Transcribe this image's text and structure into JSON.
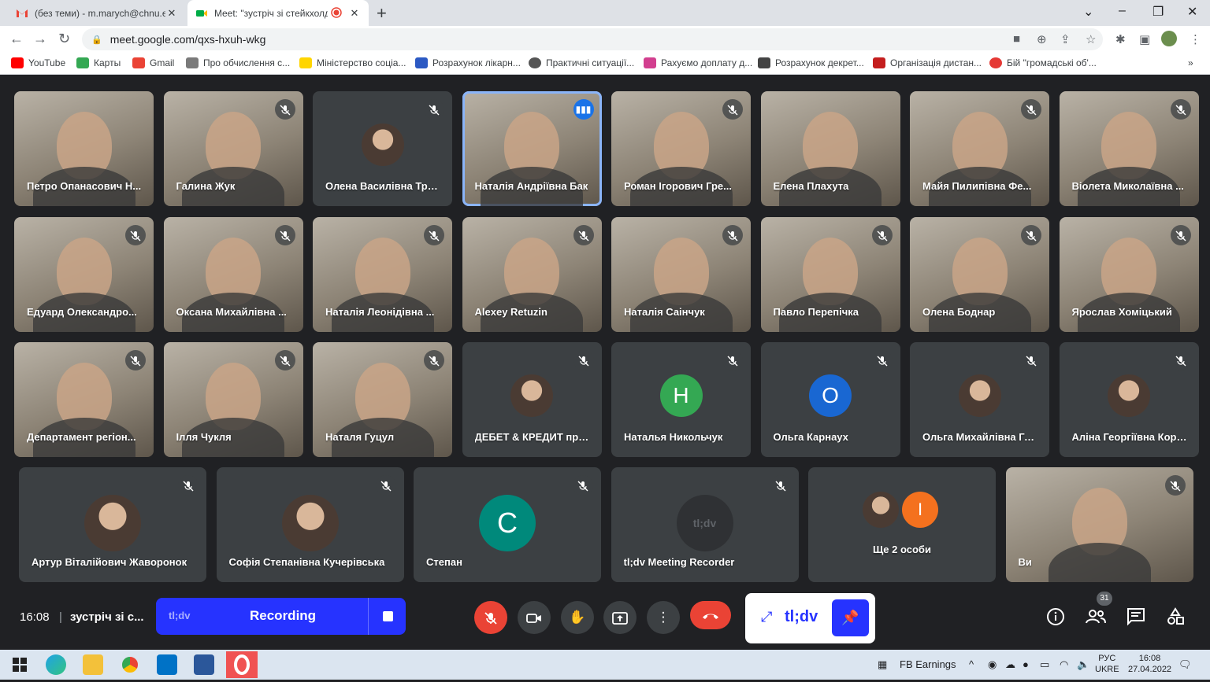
{
  "browser": {
    "tabs": [
      {
        "title": "(без теми) - m.marych@chnu.edu.ua"
      },
      {
        "title": "Meet: \"зустріч зі стейкхолдерами\""
      }
    ],
    "url": "meet.google.com/qxs-hxuh-wkg",
    "bookmarks": [
      "YouTube",
      "Карты",
      "Gmail",
      "Про обчислення с...",
      "Міністерство соціа...",
      "Розрахунок лікарн...",
      "Практичні ситуації...",
      "Рахуємо доплату д...",
      "Розрахунок декрет...",
      "Організація дистан...",
      "Бій \"громадські об'..."
    ]
  },
  "participants": [
    {
      "name": "Петро Опанасович Н...",
      "muted": false,
      "kind": "video"
    },
    {
      "name": "Галина Жук",
      "muted": true,
      "kind": "video"
    },
    {
      "name": "Олена Василівна Трет...",
      "muted": true,
      "kind": "photo"
    },
    {
      "name": "Наталія Андріївна Бак",
      "muted": false,
      "kind": "video",
      "speaking": true
    },
    {
      "name": "Роман Ігорович Гре...",
      "muted": true,
      "kind": "video"
    },
    {
      "name": "Елена Плахута",
      "muted": false,
      "kind": "video"
    },
    {
      "name": "Майя Пилипівна Фе...",
      "muted": true,
      "kind": "video"
    },
    {
      "name": "Віолета Миколаївна ...",
      "muted": true,
      "kind": "video"
    },
    {
      "name": "Едуард Олександро...",
      "muted": true,
      "kind": "video"
    },
    {
      "name": "Оксана Михайлівна ...",
      "muted": true,
      "kind": "video"
    },
    {
      "name": "Наталія Леонідівна ...",
      "muted": true,
      "kind": "video"
    },
    {
      "name": "Alexey Retuzin",
      "muted": true,
      "kind": "video"
    },
    {
      "name": "Наталія Саінчук",
      "muted": true,
      "kind": "video"
    },
    {
      "name": "Павло Перепічка",
      "muted": true,
      "kind": "video"
    },
    {
      "name": "Олена Боднар",
      "muted": true,
      "kind": "video"
    },
    {
      "name": "Ярослав Хоміцький",
      "muted": true,
      "kind": "video"
    },
    {
      "name": "Департамент регіон...",
      "muted": true,
      "kind": "video"
    },
    {
      "name": "Ілля Чукля",
      "muted": true,
      "kind": "video"
    },
    {
      "name": "Наталя Гуцул",
      "muted": true,
      "kind": "video"
    },
    {
      "name": "ДЕБЕТ & КРЕДИТ про...",
      "muted": true,
      "kind": "photo"
    },
    {
      "name": "Наталья Никольчук",
      "muted": true,
      "kind": "letter",
      "letter": "Н",
      "color": "#34a853"
    },
    {
      "name": "Ольга Карнаух",
      "muted": true,
      "kind": "letter",
      "letter": "О",
      "color": "#1967d2"
    },
    {
      "name": "Ольга Михайлівна Гл...",
      "muted": true,
      "kind": "photo"
    },
    {
      "name": "Аліна Георгіївна Корб...",
      "muted": true,
      "kind": "photo"
    },
    {
      "name": "Артур Віталійович Жаворонок",
      "muted": true,
      "kind": "photo"
    },
    {
      "name": "Софія Степанівна Кучерівська",
      "muted": true,
      "kind": "photo"
    },
    {
      "name": "Степан",
      "muted": true,
      "kind": "letter",
      "letter": "С",
      "color": "#00897b"
    },
    {
      "name": "tl;dv Meeting Recorder",
      "muted": true,
      "kind": "tldv",
      "logo": "tl;dv"
    },
    {
      "name": "Ще 2 особи",
      "muted": false,
      "kind": "more",
      "letter": "І",
      "color": "#f4711e"
    },
    {
      "name": "Ви",
      "muted": true,
      "kind": "video"
    }
  ],
  "meeting": {
    "time": "16:08",
    "separator": "|",
    "name": "зустріч зі с...",
    "people_count": "31"
  },
  "recording": {
    "brand": "tl;dv",
    "label": "Recording"
  },
  "tldv_widget": {
    "brand": "tl;dv"
  },
  "taskbar": {
    "widget": "FB Earnings",
    "lang_top": "РУС",
    "lang_bottom": "UKRE",
    "time": "16:08",
    "date": "27.04.2022"
  },
  "icons": {
    "mic_off": "mic-off-icon",
    "camera": "camera-icon",
    "hand": "raise-hand-icon",
    "present": "present-icon",
    "more": "more-options-icon",
    "hangup": "hang-up-icon",
    "info": "info-icon",
    "people": "people-icon",
    "chat": "chat-icon",
    "activities": "activities-icon"
  }
}
